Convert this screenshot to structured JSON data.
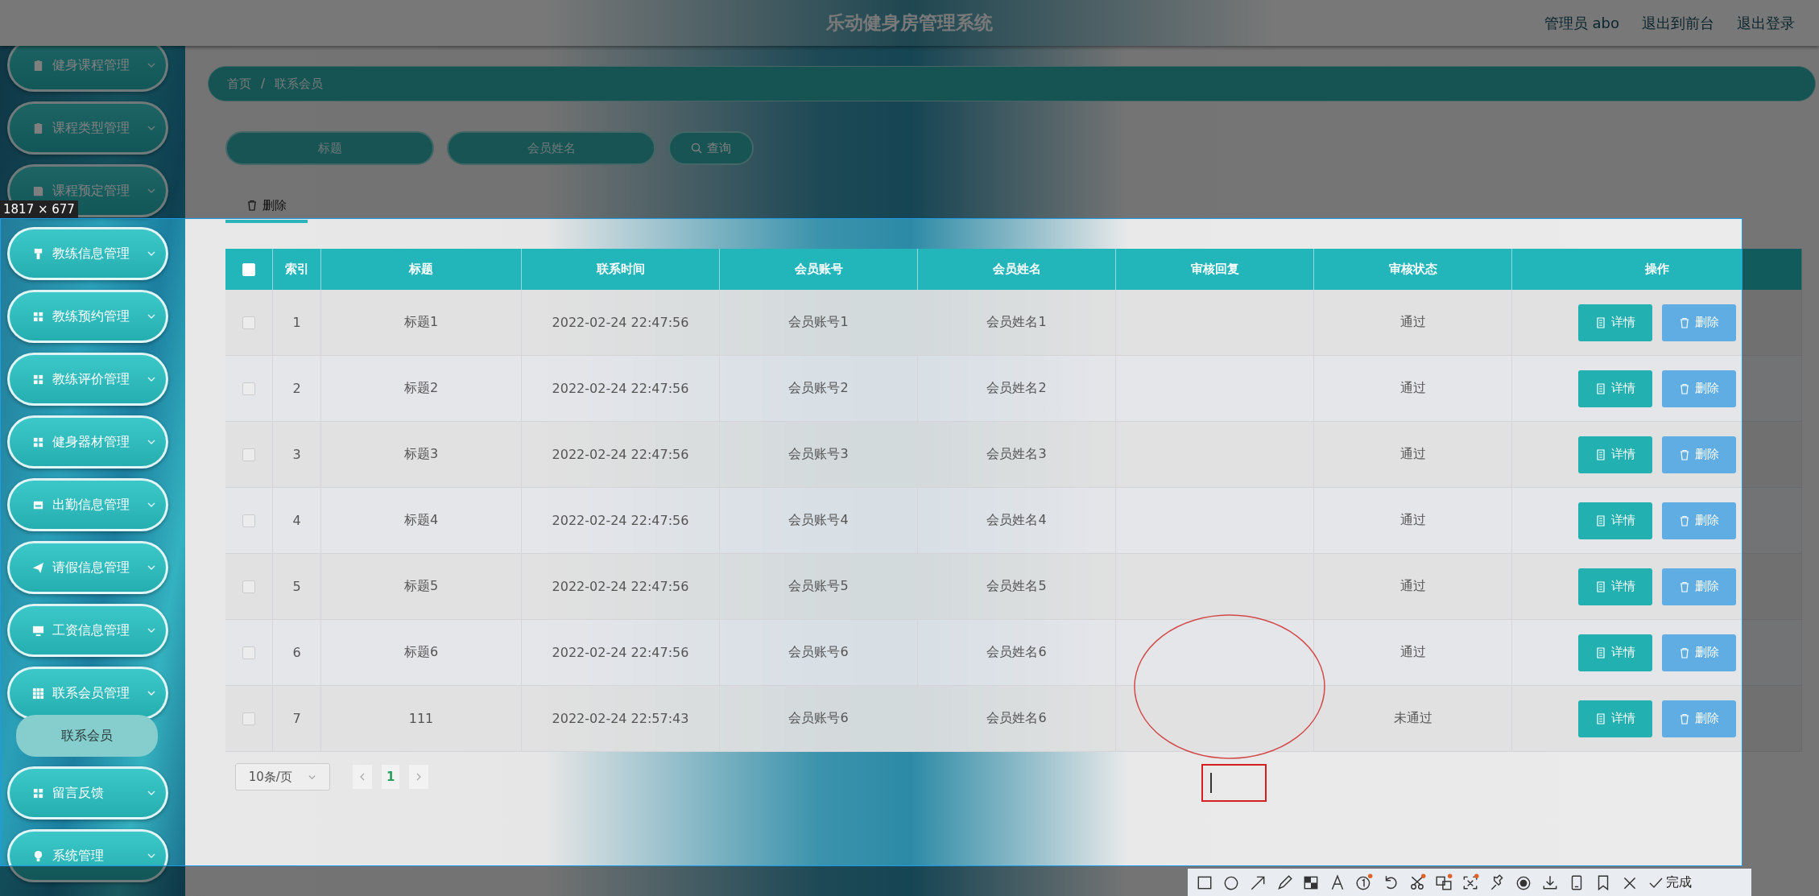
{
  "header": {
    "title": "乐动健身房管理系统",
    "user": "管理员 abo",
    "links": [
      "退出到前台",
      "退出登录"
    ]
  },
  "sidebar": {
    "items": [
      {
        "label": "健身课程管理",
        "expanded": false
      },
      {
        "label": "课程类型管理",
        "expanded": false
      },
      {
        "label": "课程预定管理",
        "expanded": false
      },
      {
        "label": "教练信息管理",
        "expanded": false
      },
      {
        "label": "教练预约管理",
        "expanded": false
      },
      {
        "label": "教练评价管理",
        "expanded": false
      },
      {
        "label": "健身器材管理",
        "expanded": false
      },
      {
        "label": "出勤信息管理",
        "expanded": false
      },
      {
        "label": "请假信息管理",
        "expanded": false
      },
      {
        "label": "工资信息管理",
        "expanded": false
      },
      {
        "label": "联系会员管理",
        "expanded": true,
        "children": [
          {
            "label": "联系会员",
            "selected": true
          }
        ]
      },
      {
        "label": "留言反馈",
        "expanded": false
      },
      {
        "label": "系统管理",
        "expanded": false
      }
    ]
  },
  "breadcrumb": {
    "items": [
      "首页",
      "联系会员"
    ],
    "separator": "/"
  },
  "search": {
    "fields": [
      {
        "placeholder": "标题"
      },
      {
        "placeholder": "会员姓名"
      }
    ],
    "button": "查询"
  },
  "actions": {
    "delete": "删除"
  },
  "table": {
    "select_all": false,
    "columns": [
      "索引",
      "标题",
      "联系时间",
      "会员账号",
      "会员姓名",
      "审核回复",
      "审核状态",
      "操作"
    ],
    "rows": [
      {
        "checked": false,
        "index": "1",
        "title": "标题1",
        "contact_time": "2022-02-24 22:47:56",
        "account": "会员账号1",
        "member_name": "会员姓名1",
        "status": "通过",
        "buttons": [
          "详情",
          "删除"
        ]
      },
      {
        "checked": false,
        "index": "2",
        "title": "标题2",
        "contact_time": "2022-02-24 22:47:56",
        "account": "会员账号2",
        "member_name": "会员姓名2",
        "status": "通过",
        "buttons": [
          "详情",
          "删除"
        ]
      },
      {
        "checked": false,
        "index": "3",
        "title": "标题3",
        "contact_time": "2022-02-24 22:47:56",
        "account": "会员账号3",
        "member_name": "会员姓名3",
        "status": "通过",
        "buttons": [
          "详情",
          "删除"
        ]
      },
      {
        "checked": false,
        "index": "4",
        "title": "标题4",
        "contact_time": "2022-02-24 22:47:56",
        "account": "会员账号4",
        "member_name": "会员姓名4",
        "status": "通过",
        "buttons": [
          "详情",
          "删除"
        ]
      },
      {
        "checked": false,
        "index": "5",
        "title": "标题5",
        "contact_time": "2022-02-24 22:47:56",
        "account": "会员账号5",
        "member_name": "会员姓名5",
        "status": "通过",
        "buttons": [
          "详情",
          "删除"
        ]
      },
      {
        "checked": false,
        "index": "6",
        "title": "标题6",
        "contact_time": "2022-02-24 22:47:56",
        "account": "会员账号6",
        "member_name": "会员姓名6",
        "status": "通过",
        "buttons": [
          "详情",
          "删除"
        ]
      },
      {
        "checked": false,
        "index": "7",
        "title": "111",
        "contact_time": "2022-02-24 22:57:43",
        "account": "会员账号6",
        "member_name": "会员姓名6",
        "status": "未通过",
        "buttons": [
          "详情",
          "删除"
        ]
      }
    ]
  },
  "pagination": {
    "page_size": "10条/页",
    "pages": [
      {
        "label": "1",
        "selected": true
      }
    ]
  },
  "capture_tool": {
    "size_label": "1817 × 677",
    "done": "完成"
  }
}
